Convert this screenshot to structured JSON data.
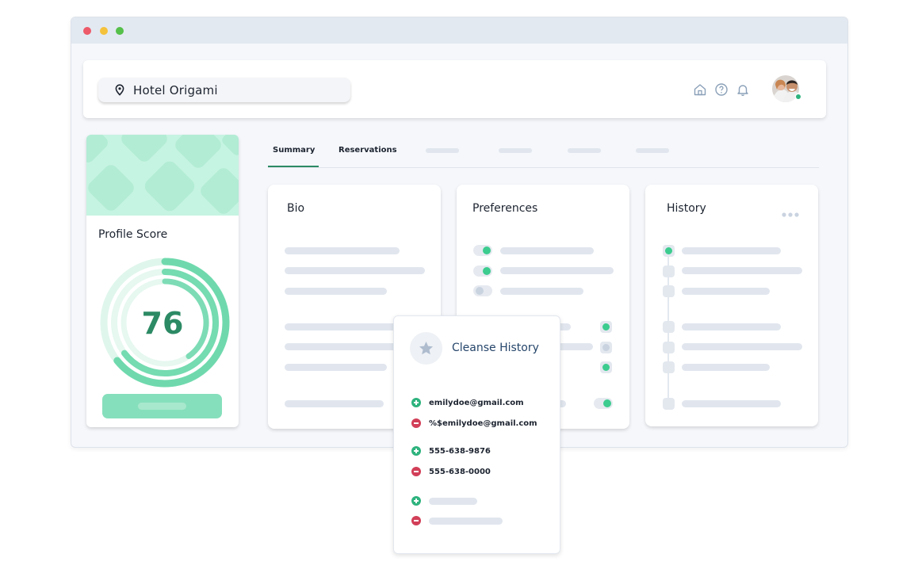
{
  "window": {
    "controls": [
      "close",
      "minimize",
      "maximize"
    ],
    "colors": {
      "close": "#ed5a69",
      "minimize": "#f5c23c",
      "maximize": "#55c04a"
    }
  },
  "header": {
    "location": "Hotel Origami",
    "icons": [
      "home-icon",
      "help-icon",
      "bell-icon"
    ],
    "avatar": "user-avatar",
    "online_status_color": "#2eb37e"
  },
  "profile": {
    "title": "Profile Score",
    "score": "76",
    "accent_color": "#2c8a64"
  },
  "tabs": [
    {
      "label": "Summary",
      "active": true
    },
    {
      "label": "Reservations",
      "active": false
    }
  ],
  "cards": {
    "bio": {
      "title": "Bio"
    },
    "preferences": {
      "title": "Preferences"
    },
    "history": {
      "title": "History",
      "menu": "more-dots-icon"
    }
  },
  "popup": {
    "title": "Cleanse History",
    "entries": [
      {
        "type": "add",
        "text": "emilydoe@gmail.com"
      },
      {
        "type": "remove",
        "text": "%$emilydoe@gmail.com"
      },
      {
        "type": "add",
        "text": "555-638-9876"
      },
      {
        "type": "remove",
        "text": "555-638-0000"
      }
    ]
  }
}
